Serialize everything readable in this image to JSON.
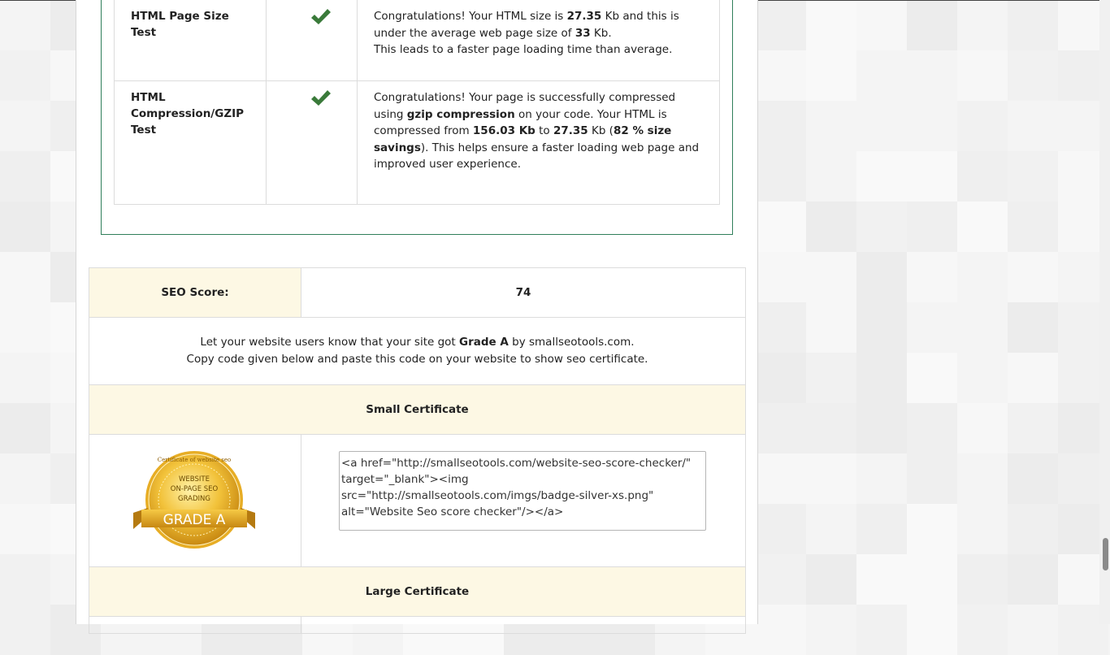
{
  "tests": [
    {
      "name": "HTML Page Size Test",
      "status_icon": "check-icon",
      "desc": [
        {
          "t": "Congratulations! Your HTML size is "
        },
        {
          "t": "27.35",
          "b": true
        },
        {
          "t": " Kb and this is under the average web page size of "
        },
        {
          "t": "33",
          "b": true
        },
        {
          "t": " Kb."
        },
        {
          "br": true
        },
        {
          "t": "This leads to a faster page loading time than average."
        }
      ]
    },
    {
      "name": "HTML Compression/GZIP Test",
      "status_icon": "check-icon",
      "desc": [
        {
          "t": "Congratulations! Your page is successfully compressed using "
        },
        {
          "t": "gzip compression",
          "b": true
        },
        {
          "t": " on your code. Your HTML is compressed from "
        },
        {
          "t": "156.03 Kb",
          "b": true
        },
        {
          "t": " to "
        },
        {
          "t": "27.35",
          "b": true
        },
        {
          "t": " Kb ("
        },
        {
          "t": "82 % size savings",
          "b": true
        },
        {
          "t": "). This helps ensure a faster loading web page and improved user experience."
        }
      ]
    }
  ],
  "score": {
    "label": "SEO Score:",
    "value": "74"
  },
  "message": {
    "line1_pre": "Let your website users know that your site got ",
    "grade": "Grade A",
    "line1_post": " by smallseotools.com.",
    "line2": "Copy code given below and paste this code on your website to show seo certificate."
  },
  "small_certificate": {
    "heading": "Small Certificate",
    "code": "<a href=\"http://smallseotools.com/website-seo-score-checker/\" target=\"_blank\"><img src=\"http://smallseotools.com/imgs/badge-silver-xs.png\" alt=\"Website Seo score checker\"/></a>",
    "badge": {
      "ring_text": "Certificate of website seo",
      "line1": "WEBSITE",
      "line2": "ON-PAGE SEO",
      "line3": "GRADING",
      "grade": "GRADE A"
    }
  },
  "large_certificate": {
    "heading": "Large Certificate"
  },
  "colors": {
    "accent_green": "#2f7f5a",
    "check_green": "#3a7a3a",
    "header_bg": "#fdf8e4"
  }
}
